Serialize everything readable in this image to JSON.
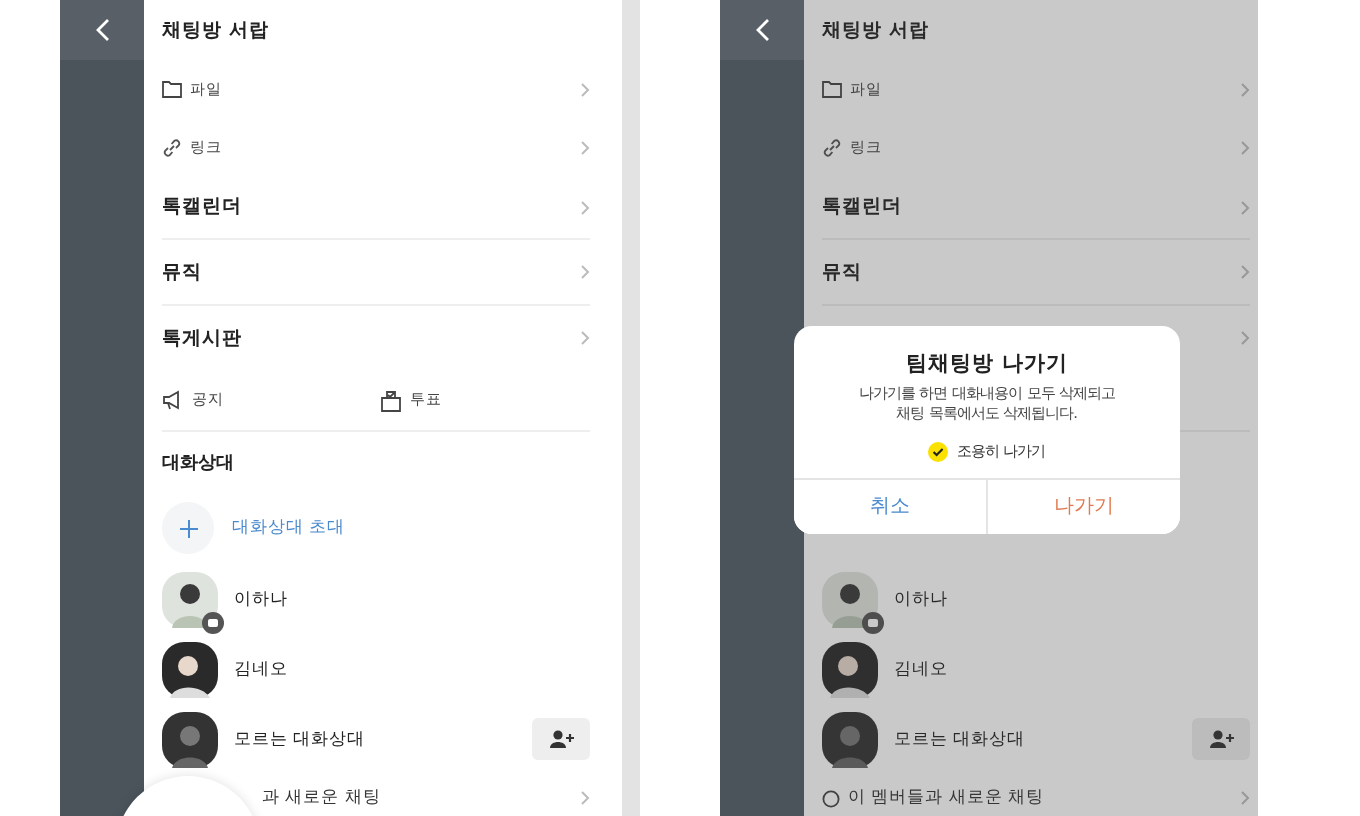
{
  "screens": [
    {
      "dimmed": false,
      "title": "채팅방 서랍",
      "menu": [
        {
          "kind": "file",
          "label": "파일"
        },
        {
          "kind": "link",
          "label": "링크"
        },
        {
          "kind": "bold",
          "label": "톡캘린더"
        },
        {
          "kind": "bold",
          "label": "뮤직"
        },
        {
          "kind": "bold",
          "label": "톡게시판"
        }
      ],
      "shortcuts": [
        {
          "kind": "notice",
          "label": "공지"
        },
        {
          "kind": "vote",
          "label": "투표"
        }
      ],
      "section": "대화상대",
      "invite": "대화상대 초대",
      "members": [
        {
          "kind": "me",
          "name": "이하나"
        },
        {
          "kind": "friend",
          "name": "김네오"
        },
        {
          "kind": "unknown",
          "name": "모르는 대화상대"
        }
      ],
      "footer": {
        "kind": "covered",
        "label": "과 새로운 채팅"
      }
    },
    {
      "dimmed": true,
      "title": "채팅방 서랍",
      "menu": [
        {
          "kind": "file",
          "label": "파일"
        },
        {
          "kind": "link",
          "label": "링크"
        },
        {
          "kind": "bold",
          "label": "톡캘린더"
        },
        {
          "kind": "bold",
          "label": "뮤직"
        },
        {
          "kind": "blank"
        }
      ],
      "members": [
        {
          "kind": "me",
          "name": "이하나"
        },
        {
          "kind": "friend",
          "name": "김네오"
        },
        {
          "kind": "unknown",
          "name": "모르는 대화상대"
        }
      ],
      "footer": {
        "kind": "new-chat",
        "label": "이 멤버들과 새로운 채팅"
      },
      "dialog": {
        "title": "팀채팅방 나가기",
        "message": "나가기를 하면 대화내용이 모두 삭제되고\n채팅 목록에서도 삭제됩니다.",
        "quiet_leave": {
          "label": "조용히 나가기",
          "checked": true
        },
        "buttons": [
          {
            "kind": "cancel",
            "label": "취소"
          },
          {
            "kind": "confirm",
            "label": "나가기"
          }
        ]
      }
    }
  ]
}
